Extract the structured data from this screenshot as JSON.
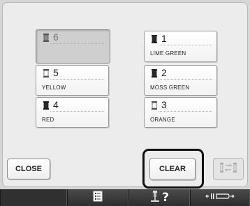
{
  "spools": [
    {
      "number": "6",
      "name": "",
      "selected": true,
      "spool_color": "#8a8a8a"
    },
    {
      "number": "1",
      "name": "LIME GREEN",
      "selected": false,
      "spool_color": "#2a2a2a"
    },
    {
      "number": "5",
      "name": "YELLOW",
      "selected": false,
      "spool_color": "#ffffff"
    },
    {
      "number": "2",
      "name": "MOSS GREEN",
      "selected": false,
      "spool_color": "#2a2a2a"
    },
    {
      "number": "4",
      "name": "RED",
      "selected": false,
      "spool_color": "#2a2a2a"
    },
    {
      "number": "3",
      "name": "ORANGE",
      "selected": false,
      "spool_color": "#ffffff"
    }
  ],
  "buttons": {
    "close_label": "CLOSE",
    "clear_label": "CLEAR"
  },
  "bottom_bar": {
    "help_label": "?",
    "icons": [
      "checklist-icon",
      "needle-help-icon",
      "presser-foot-icon"
    ]
  },
  "colors": {
    "highlight": "#111111",
    "bar": "#2b2b2b"
  }
}
